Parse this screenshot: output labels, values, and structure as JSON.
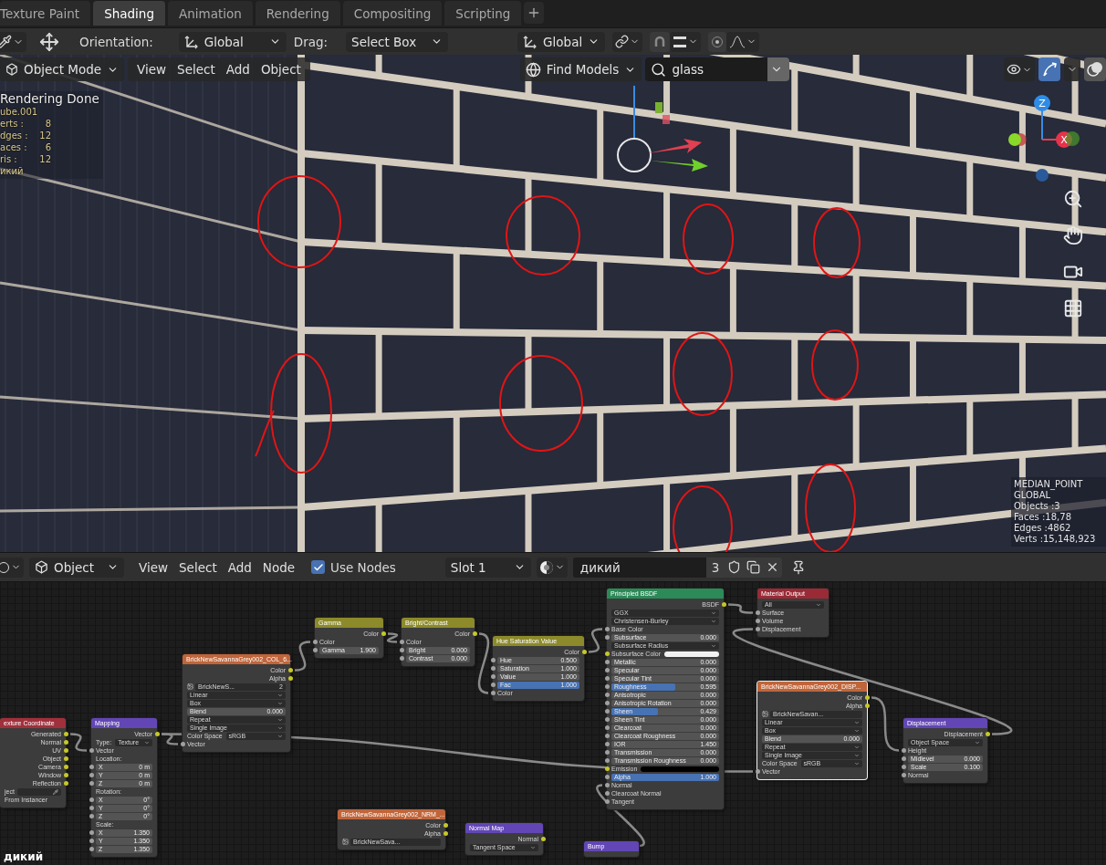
{
  "workspace_tabs": [
    {
      "label": "Texture Paint",
      "selected": false
    },
    {
      "label": "Shading",
      "selected": true
    },
    {
      "label": "Animation",
      "selected": false
    },
    {
      "label": "Rendering",
      "selected": false
    },
    {
      "label": "Compositing",
      "selected": false
    },
    {
      "label": "Scripting",
      "selected": false
    }
  ],
  "tool_header": {
    "orientation_label": "Orientation:",
    "orientation": "Global",
    "drag_label": "Drag:",
    "drag": "Select Box",
    "transform_orientation": "Global"
  },
  "viewport": {
    "mode": "Object Mode",
    "menus": [
      "View",
      "Select",
      "Add",
      "Object"
    ],
    "asset_filter": "Find Models",
    "search": "glass",
    "overlay_title": "Rendering Done",
    "object_name": "ube.001",
    "stats": [
      {
        "label": "erts :",
        "value": "8"
      },
      {
        "label": "dges :",
        "value": "12"
      },
      {
        "label": "aces :",
        "value": "6"
      },
      {
        "label": "ris :",
        "value": "12"
      }
    ],
    "material_name": "икий",
    "axis_labels": [
      "Z",
      "X"
    ],
    "scene_stats": [
      "MEDIAN_POINT",
      "GLOBAL",
      "Objects :3",
      "Faces :18,78",
      "Edges :4862",
      "Verts :15,148,923"
    ]
  },
  "node_header": {
    "editor": "Object",
    "menus": [
      "View",
      "Select",
      "Add",
      "Node"
    ],
    "use_nodes": {
      "label": "Use Nodes",
      "checked": true
    },
    "slot": "Slot 1",
    "material": "дикий",
    "users": "3"
  },
  "nodes": [
    {
      "title": "exture Coordinate",
      "kind": "input",
      "selected": false,
      "rows": [
        {
          "kind": "out",
          "label": "Generated"
        },
        {
          "kind": "out",
          "label": "Normal"
        },
        {
          "kind": "out",
          "label": "UV"
        },
        {
          "kind": "out",
          "label": "Object"
        },
        {
          "kind": "out",
          "label": "Camera"
        },
        {
          "kind": "out",
          "label": "Window"
        },
        {
          "kind": "out",
          "label": "Reflection"
        },
        {
          "kind": "object",
          "label": "ject"
        },
        {
          "kind": "label",
          "label": "From Instancer"
        }
      ]
    },
    {
      "title": "Mapping",
      "kind": "vector",
      "selected": false,
      "rows": [
        {
          "kind": "out",
          "label": "Vector"
        },
        {
          "kind": "select",
          "label": "Type:",
          "value": "Texture"
        },
        {
          "kind": "in",
          "label": "Vector"
        },
        {
          "kind": "label",
          "label": "Location:"
        },
        {
          "kind": "value",
          "label": "X",
          "value": "0 m"
        },
        {
          "kind": "value",
          "label": "Y",
          "value": "0 m"
        },
        {
          "kind": "value",
          "label": "Z",
          "value": "0 m"
        },
        {
          "kind": "label",
          "label": "Rotation:"
        },
        {
          "kind": "value",
          "label": "X",
          "value": "0°"
        },
        {
          "kind": "value",
          "label": "Y",
          "value": "0°"
        },
        {
          "kind": "value",
          "label": "Z",
          "value": "0°"
        },
        {
          "kind": "label",
          "label": "Scale:"
        },
        {
          "kind": "value",
          "label": "X",
          "value": "1.350"
        },
        {
          "kind": "value",
          "label": "Y",
          "value": "1.350"
        },
        {
          "kind": "value",
          "label": "Z",
          "value": "1.350"
        }
      ]
    },
    {
      "title": "BrickNewSavannaGrey002_COL_6...",
      "kind": "texture",
      "selected": false,
      "rows": [
        {
          "kind": "out",
          "label": "Color"
        },
        {
          "kind": "out",
          "label": "Alpha"
        },
        {
          "kind": "image",
          "value": "BrickNewS...",
          "users": "2"
        },
        {
          "kind": "select",
          "value": "Linear"
        },
        {
          "kind": "select",
          "value": "Box"
        },
        {
          "kind": "value",
          "label": "Blend",
          "value": "0.000"
        },
        {
          "kind": "select",
          "value": "Repeat"
        },
        {
          "kind": "select",
          "value": "Single Image"
        },
        {
          "kind": "select",
          "label": "Color Space",
          "value": "sRGB"
        },
        {
          "kind": "in",
          "label": "Vector"
        }
      ]
    },
    {
      "title": "Gamma",
      "kind": "color",
      "selected": false,
      "rows": [
        {
          "kind": "out",
          "label": "Color"
        },
        {
          "kind": "in",
          "label": "Color"
        },
        {
          "kind": "value",
          "label": "Gamma",
          "value": "1.900"
        }
      ]
    },
    {
      "title": "Bright/Contrast",
      "kind": "color",
      "selected": false,
      "rows": [
        {
          "kind": "out",
          "label": "Color"
        },
        {
          "kind": "in",
          "label": "Color"
        },
        {
          "kind": "value",
          "label": "Bright",
          "value": "0.000"
        },
        {
          "kind": "value",
          "label": "Contrast",
          "value": "0.000"
        }
      ]
    },
    {
      "title": "Hue Saturation Value",
      "kind": "color",
      "selected": false,
      "rows": [
        {
          "kind": "out",
          "label": "Color"
        },
        {
          "kind": "value",
          "label": "Hue",
          "value": "0.500"
        },
        {
          "kind": "value",
          "label": "Saturation",
          "value": "1.000"
        },
        {
          "kind": "value",
          "label": "Value",
          "value": "1.000"
        },
        {
          "kind": "value",
          "label": "Fac",
          "value": "1.000",
          "level": 1
        },
        {
          "kind": "in",
          "label": "Color"
        }
      ]
    },
    {
      "title": "Principled BSDF",
      "kind": "shader",
      "selected": false,
      "rows": [
        {
          "kind": "out",
          "label": "BSDF"
        },
        {
          "kind": "select",
          "value": "GGX"
        },
        {
          "kind": "select",
          "value": "Christensen-Burley"
        },
        {
          "kind": "in",
          "label": "Base Color"
        },
        {
          "kind": "value",
          "label": "Subsurface",
          "value": "0.000"
        },
        {
          "kind": "select",
          "label": "Subsurface Radius"
        },
        {
          "kind": "color",
          "label": "Subsurface Color",
          "color": "#f2f2f2"
        },
        {
          "kind": "value",
          "label": "Metallic",
          "value": "0.000"
        },
        {
          "kind": "value",
          "label": "Specular",
          "value": "0.000"
        },
        {
          "kind": "value",
          "label": "Specular Tint",
          "value": "0.000"
        },
        {
          "kind": "value",
          "label": "Roughness",
          "value": "0.595",
          "level": 0.595
        },
        {
          "kind": "value",
          "label": "Anisotropic",
          "value": "0.000"
        },
        {
          "kind": "value",
          "label": "Anisotropic Rotation",
          "value": "0.000"
        },
        {
          "kind": "value",
          "label": "Sheen",
          "value": "0.429",
          "level": 0.429
        },
        {
          "kind": "value",
          "label": "Sheen Tint",
          "value": "0.000"
        },
        {
          "kind": "value",
          "label": "Clearcoat",
          "value": "0.000"
        },
        {
          "kind": "value",
          "label": "Clearcoat Roughness",
          "value": "0.000"
        },
        {
          "kind": "value",
          "label": "IOR",
          "value": "1.450"
        },
        {
          "kind": "value",
          "label": "Transmission",
          "value": "0.000"
        },
        {
          "kind": "value",
          "label": "Transmission Roughness",
          "value": "0.000"
        },
        {
          "kind": "color",
          "label": "Emission",
          "color": "#000000"
        },
        {
          "kind": "value",
          "label": "Alpha",
          "value": "1.000",
          "level": 1
        },
        {
          "kind": "in",
          "label": "Normal"
        },
        {
          "kind": "in",
          "label": "Clearcoat Normal"
        },
        {
          "kind": "in",
          "label": "Tangent"
        }
      ]
    },
    {
      "title": "Material Output",
      "kind": "output",
      "selected": false,
      "rows": [
        {
          "kind": "select",
          "value": "All"
        },
        {
          "kind": "in",
          "label": "Surface"
        },
        {
          "kind": "in",
          "label": "Volume"
        },
        {
          "kind": "in",
          "label": "Displacement"
        }
      ]
    },
    {
      "title": "BrickNewSavannaGrey002_DISP...",
      "kind": "texture",
      "selected": true,
      "rows": [
        {
          "kind": "out",
          "label": "Color"
        },
        {
          "kind": "out",
          "label": "Alpha"
        },
        {
          "kind": "image",
          "value": "BrickNewSavan..."
        },
        {
          "kind": "select",
          "value": "Linear"
        },
        {
          "kind": "select",
          "value": "Box"
        },
        {
          "kind": "value",
          "label": "Blend",
          "value": "0.000"
        },
        {
          "kind": "select",
          "value": "Repeat"
        },
        {
          "kind": "select",
          "value": "Single Image"
        },
        {
          "kind": "select",
          "label": "Color Space",
          "value": "sRGB"
        },
        {
          "kind": "in",
          "label": "Vector"
        }
      ]
    },
    {
      "title": "Displacement",
      "kind": "vector",
      "selected": false,
      "rows": [
        {
          "kind": "out",
          "label": "Displacement"
        },
        {
          "kind": "select",
          "value": "Object Space"
        },
        {
          "kind": "in",
          "label": "Height"
        },
        {
          "kind": "value",
          "label": "Midlevel",
          "value": "0.000"
        },
        {
          "kind": "value",
          "label": "Scale",
          "value": "0.100"
        },
        {
          "kind": "in",
          "label": "Normal"
        }
      ]
    },
    {
      "title": "BrickNewSavannaGrey002_NRM_...",
      "kind": "texture",
      "selected": false,
      "rows": [
        {
          "kind": "out",
          "label": "Color"
        },
        {
          "kind": "out",
          "label": "Alpha"
        },
        {
          "kind": "image",
          "value": "BrickNewSava..."
        }
      ]
    },
    {
      "title": "Normal Map",
      "kind": "vector",
      "selected": false,
      "rows": [
        {
          "kind": "out",
          "label": "Normal"
        },
        {
          "kind": "select",
          "value": "Tangent Space"
        }
      ]
    },
    {
      "title": "Bump",
      "kind": "vector",
      "selected": false
    }
  ],
  "canvas_label": "дикий"
}
